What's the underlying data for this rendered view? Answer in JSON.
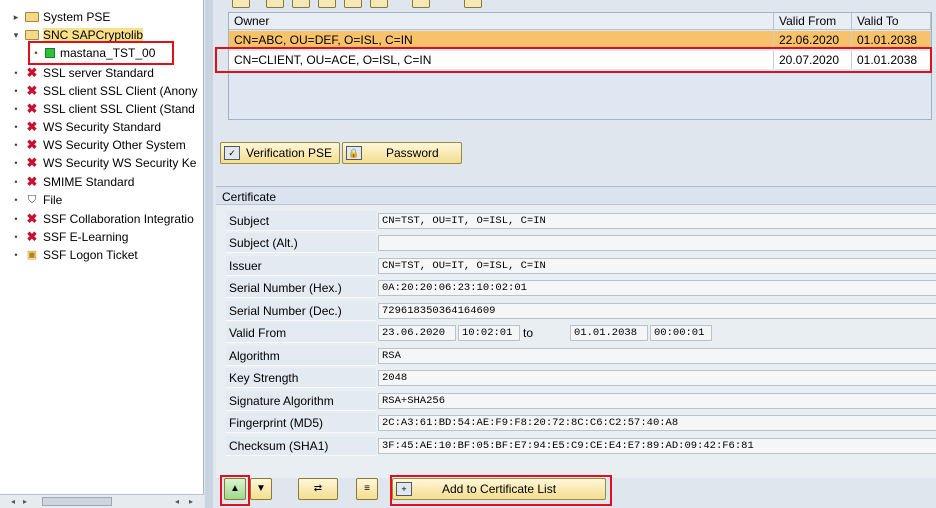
{
  "tree": {
    "items": [
      {
        "label": "System PSE",
        "icon": "folder-icon"
      },
      {
        "label": "SNC SAPCryptolib",
        "icon": "folder-open-icon"
      },
      {
        "label": "mastana_TST_00",
        "icon": "green-status-icon"
      },
      {
        "label": "SSL server Standard",
        "icon": "red-x-icon"
      },
      {
        "label": "SSL client SSL Client (Anony",
        "icon": "red-x-icon"
      },
      {
        "label": "SSL client SSL Client (Stand",
        "icon": "red-x-icon"
      },
      {
        "label": "WS Security Standard",
        "icon": "red-x-icon"
      },
      {
        "label": "WS Security Other System",
        "icon": "red-x-icon"
      },
      {
        "label": "WS Security WS Security Ke",
        "icon": "red-x-icon"
      },
      {
        "label": "SMIME Standard",
        "icon": "red-x-icon"
      },
      {
        "label": "File",
        "icon": "file-shield-icon"
      },
      {
        "label": "SSF Collaboration Integratio",
        "icon": "red-x-icon"
      },
      {
        "label": "SSF E-Learning",
        "icon": "red-x-icon"
      },
      {
        "label": "SSF Logon Ticket",
        "icon": "logon-ticket-icon"
      }
    ]
  },
  "cert_table": {
    "headers": [
      "Owner",
      "Valid From",
      "Valid To"
    ],
    "rows": [
      {
        "owner": "CN=ABC, OU=DEF, O=ISL, C=IN",
        "valid_from": "22.06.2020",
        "valid_to": "01.01.2038"
      },
      {
        "owner": "CN=CLIENT, OU=ACE, O=ISL, C=IN",
        "valid_from": "20.07.2020",
        "valid_to": "01.01.2038"
      }
    ]
  },
  "buttons": {
    "verification_pse": "Verification PSE",
    "password": "Password",
    "add_to_cert_list": "Add to Certificate List"
  },
  "certificate": {
    "title": "Certificate",
    "fields": {
      "subject_label": "Subject",
      "subject": "CN=TST, OU=IT, O=ISL, C=IN",
      "subject_alt_label": "Subject (Alt.)",
      "subject_alt": "",
      "issuer_label": "Issuer",
      "issuer": "CN=TST, OU=IT, O=ISL, C=IN",
      "serial_hex_label": "Serial Number (Hex.)",
      "serial_hex": "0A:20:20:06:23:10:02:01",
      "serial_dec_label": "Serial Number (Dec.)",
      "serial_dec": "729618350364164609",
      "valid_from_label": "Valid From",
      "valid_from_date": "23.06.2020",
      "valid_from_time": "10:02:01",
      "to_label": "to",
      "valid_to_date": "01.01.2038",
      "valid_to_time": "00:00:01",
      "algorithm_label": "Algorithm",
      "algorithm": "RSA",
      "key_strength_label": "Key Strength",
      "key_strength": "2048",
      "sig_alg_label": "Signature Algorithm",
      "sig_alg": "RSA+SHA256",
      "fp_md5_label": "Fingerprint (MD5)",
      "fp_md5": "2C:A3:61:BD:54:AE:F9:F8:20:72:8C:C6:C2:57:40:A8",
      "checksum_label": "Checksum (SHA1)",
      "checksum": "3F:45:AE:10:BF:05:BF:E7:94:E5:C9:CE:E4:E7:89:AD:09:42:F6:81"
    }
  }
}
